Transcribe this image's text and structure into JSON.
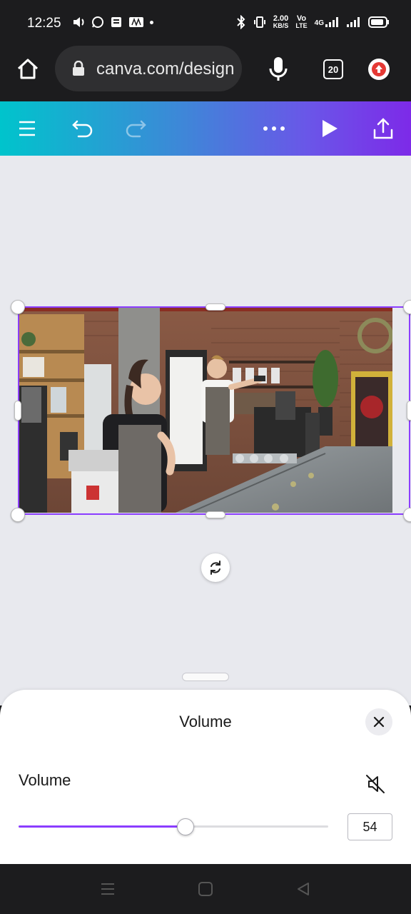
{
  "status_bar": {
    "time": "12:25",
    "net_speed_value": "2.00",
    "net_speed_unit": "KB/S",
    "volte_top": "Vo",
    "volte_bottom": "LTE",
    "network": "4G"
  },
  "browser": {
    "url": "canva.com/design",
    "tab_count": "20"
  },
  "editor": {
    "icons": [
      "menu-icon",
      "undo-icon",
      "redo-icon",
      "more-icon",
      "play-icon",
      "share-icon"
    ]
  },
  "volume_sheet": {
    "title": "Volume",
    "label": "Volume",
    "value": "54",
    "level": 0.54,
    "accent_color": "#8b3dff"
  }
}
